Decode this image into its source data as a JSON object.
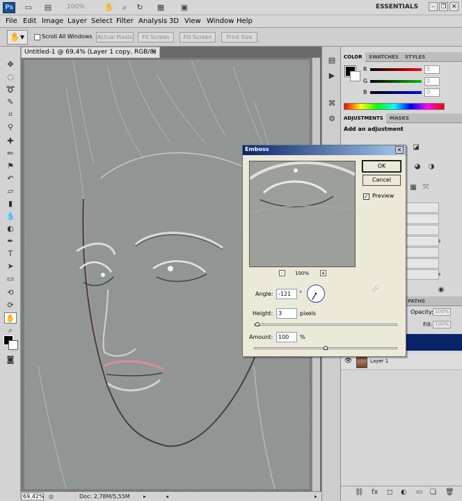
{
  "app": {
    "logo": "Ps",
    "zoom_readout": "100%",
    "workspace": "ESSENTIALS"
  },
  "menu": {
    "items": [
      "File",
      "Edit",
      "Image",
      "Layer",
      "Select",
      "Filter",
      "Analysis",
      "3D",
      "View",
      "Window",
      "Help"
    ]
  },
  "options": {
    "scroll_all_windows": "Scroll All Windows",
    "scroll_all_windows_checked": false,
    "actual_pixels": "Actual Pixels",
    "fit_screen": "Fit Screen",
    "fill_screen": "Fill Screen",
    "print_size": "Print Size"
  },
  "document": {
    "tab_title": "Untitled-1 @ 69,4% (Layer 1 copy, RGB/8) *",
    "close": "×"
  },
  "status": {
    "zoom": "69,42%",
    "doc_size": "Doc: 2,78M/5,55M"
  },
  "color_panel": {
    "tabs": [
      "COLOR",
      "SWATCHES",
      "STYLES"
    ],
    "channels": [
      {
        "label": "R",
        "value": "0",
        "color": "#c81e1e"
      },
      {
        "label": "G",
        "value": "0",
        "color": "#1e9e1e"
      },
      {
        "label": "B",
        "value": "0",
        "color": "#1e1ec8"
      }
    ]
  },
  "adjustments_panel": {
    "tabs": [
      "ADJUSTMENTS",
      "MASKS"
    ],
    "title": "Add an adjustment",
    "list_fragments": [
      "s",
      "s"
    ]
  },
  "layers_panel": {
    "tab_fragment": "PATHS",
    "opacity_label": "Opacity:",
    "opacity_value": "100%",
    "fill_label": "Fill:",
    "fill_value": "100%",
    "layers": [
      {
        "name": "Layer 1",
        "visible": true
      }
    ]
  },
  "emboss": {
    "title": "Emboss",
    "ok": "OK",
    "cancel": "Cancel",
    "preview_label": "Preview",
    "preview_checked": true,
    "zoom": "100%",
    "zoom_out": "-",
    "zoom_in": "+",
    "angle_label": "Angle:",
    "angle_value": "-121",
    "angle_unit": "°",
    "angle_degrees": -121,
    "height_label": "Height:",
    "height_value": "3",
    "height_unit": "pixels",
    "height_slider_fraction": 0.01,
    "amount_label": "Amount:",
    "amount_value": "100",
    "amount_unit": "%",
    "amount_slider_fraction": 0.5
  },
  "colors": {
    "selection_blue": "#0a246a",
    "canvas_gray": "#8d9290"
  }
}
